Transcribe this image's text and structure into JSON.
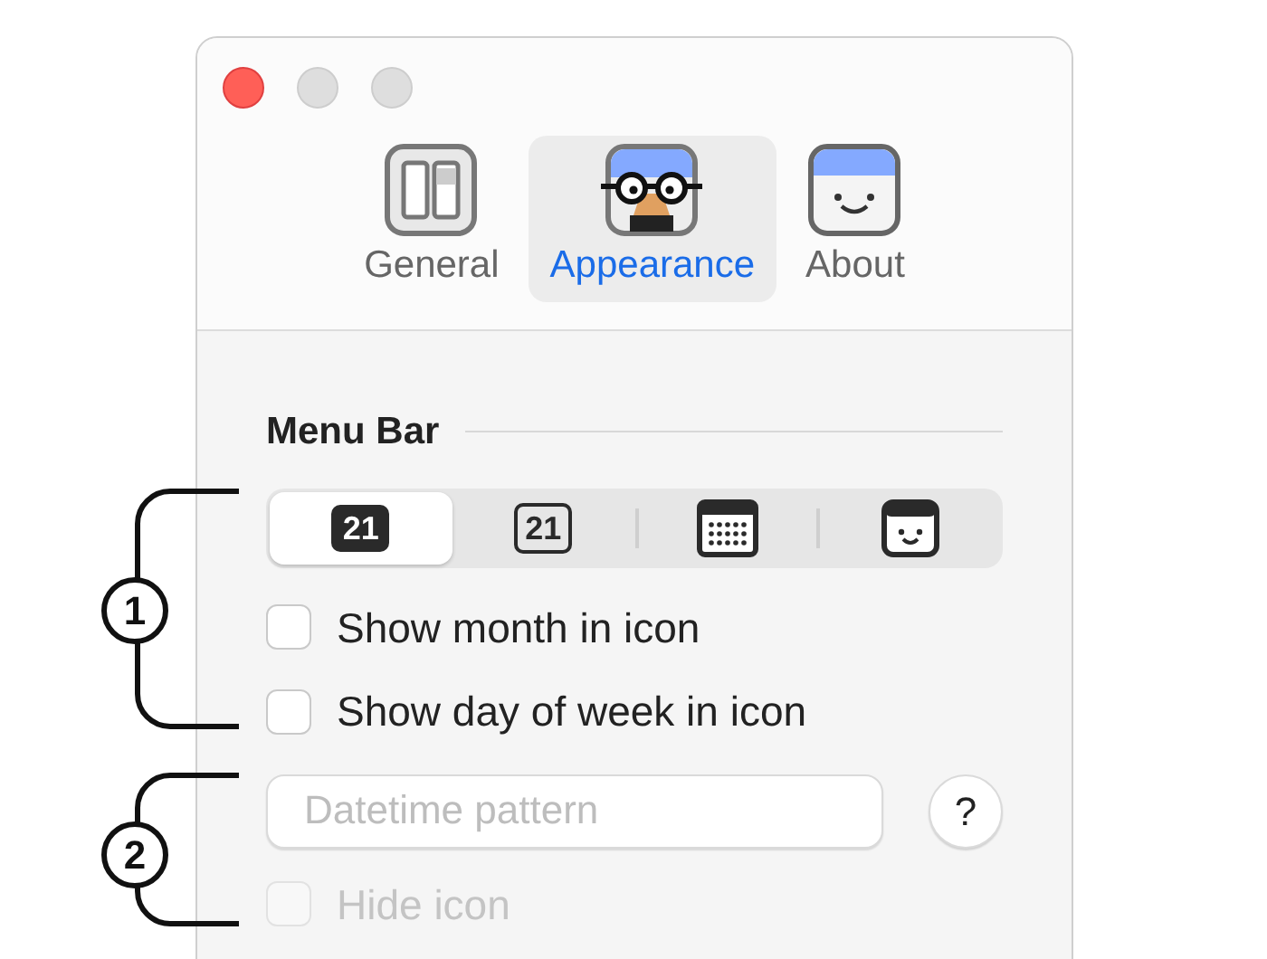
{
  "tabs": [
    {
      "label": "General",
      "kind": "general",
      "selected": false
    },
    {
      "label": "Appearance",
      "kind": "appearance",
      "selected": true
    },
    {
      "label": "About",
      "kind": "about",
      "selected": false
    }
  ],
  "section": {
    "title": "Menu Bar"
  },
  "style_options": [
    {
      "kind": "filled-date",
      "text": "21",
      "selected": true
    },
    {
      "kind": "outlined-date",
      "text": "21",
      "selected": false
    },
    {
      "kind": "calendar",
      "selected": false
    },
    {
      "kind": "face",
      "selected": false
    }
  ],
  "checkboxes": [
    {
      "label": "Show month in icon",
      "checked": false,
      "disabled": false
    },
    {
      "label": "Show day of week in icon",
      "checked": false,
      "disabled": false
    }
  ],
  "pattern_field": {
    "placeholder": "Datetime pattern"
  },
  "help_button": {
    "label": "?"
  },
  "hide_icon": {
    "label": "Hide icon",
    "checked": false,
    "disabled": true
  },
  "annotations": [
    {
      "label": "1"
    },
    {
      "label": "2"
    }
  ]
}
